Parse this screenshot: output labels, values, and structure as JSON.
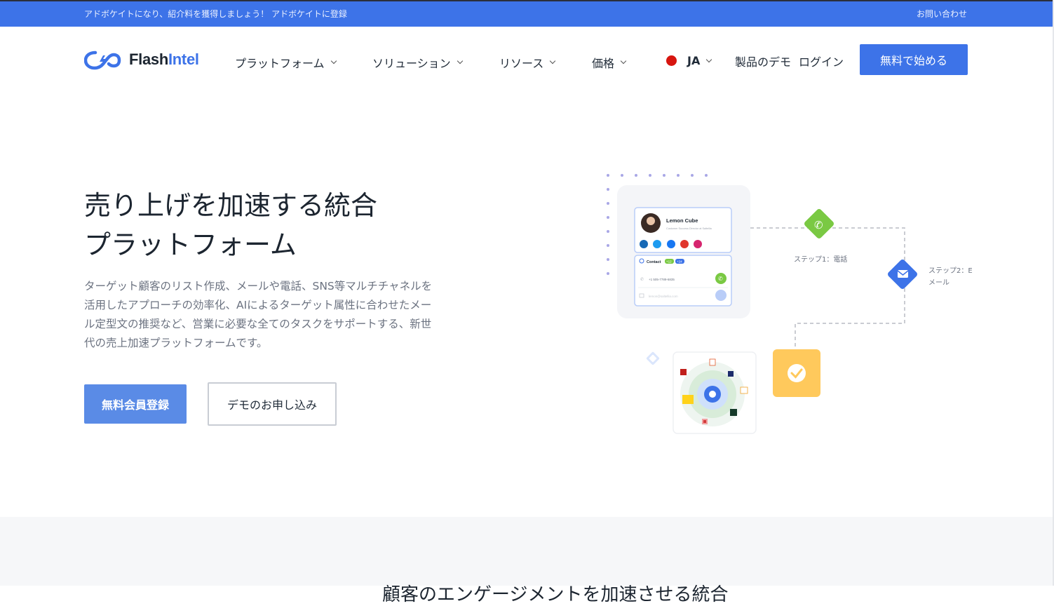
{
  "topbar": {
    "promo": "アドボケイトになり、紹介料を獲得しましょう！ アドボケイトに登録",
    "contact": "お問い合わせ"
  },
  "brand": {
    "name_flash": "Flash",
    "name_intel": "Intel",
    "accent": "#3d73e8"
  },
  "nav": {
    "items": [
      {
        "label": "プラットフォーム"
      },
      {
        "label": "ソリューション"
      },
      {
        "label": "リソース"
      },
      {
        "label": "価格"
      }
    ],
    "language": "JA",
    "demo": "製品のデモ",
    "login": "ログイン",
    "cta": "無料で始める"
  },
  "hero": {
    "title_line1": "売り上げを加速する統合",
    "title_line2": "プラットフォーム",
    "description": "ターゲット顧客のリスト作成、メールや電話、SNS等マルチチャネルを活用したアプローチの効率化、AIによるターゲット属性に合わせたメール定型文の推奨など、営業に必要な全てのタスクをサポートする、新世代の売上加速プラットフォームです。",
    "primary_button": "無料会員登録",
    "secondary_button": "デモのお申し込み"
  },
  "illustration": {
    "contact_name": "Lemon Cube",
    "contact_subtitle": "Customer Success Director at Saltellia",
    "contact_label": "Contact",
    "phone": "+1 505-7789-6835",
    "email": "lemon@saltellia.com",
    "step1": "ステップ1：電話",
    "step2_line1": "ステップ2：E",
    "step2_line2": "メール",
    "badge1": "+12",
    "badge2": "+24",
    "colors": {
      "step_green": "#7ac943",
      "step_blue": "#3d73e8",
      "step_yellow": "#ffc95c"
    }
  },
  "next_section": {
    "title": "顧客のエンゲージメントを加速させる統合"
  }
}
